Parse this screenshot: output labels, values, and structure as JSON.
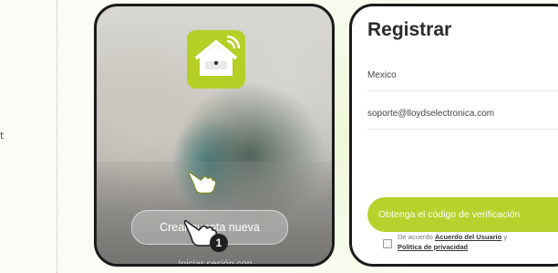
{
  "left_margin": {
    "stray_char": "t"
  },
  "signup_screen": {
    "create_button_label": "Crear cuenta nueva",
    "login_link_label": "Iniciar sesión con",
    "step_number": "1"
  },
  "register_screen": {
    "title": "Registrar",
    "country_value": "Mexico",
    "email_value": "soporte@lloydselectronica.com",
    "verify_button_label": "Obtenga el código de verificación",
    "agreement_prefix": "De acuerdo",
    "user_agreement_link": "Acuerdo del Usuario",
    "agreement_joiner": "y",
    "privacy_policy_link": "Política de privacidad"
  },
  "colors": {
    "accent_green": "#b7d22c",
    "badge_dark": "#1f1f1f"
  },
  "icons": [
    "house-logo-icon",
    "pointing-hand-icon"
  ]
}
